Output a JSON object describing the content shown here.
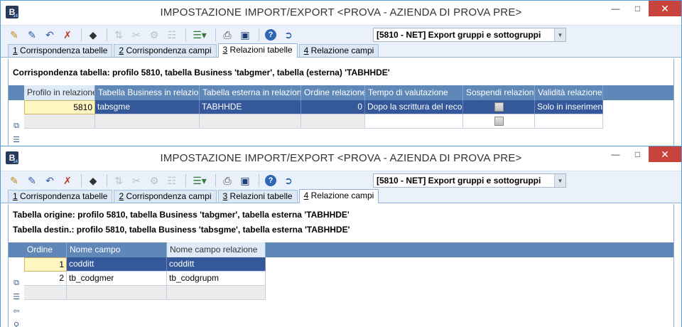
{
  "window_top": {
    "title": "IMPOSTAZIONE IMPORT/EXPORT <PROVA - AZIENDA DI PROVA PRE>",
    "logo_letter": "B",
    "logo_sub": "14",
    "toolbar": {
      "profile_value": "[5810 - NET] Export gruppi e sottogruppi"
    },
    "tabs": [
      {
        "accel": "1",
        "label": " Corrispondenza tabelle"
      },
      {
        "accel": "2",
        "label": " Corrispondenza campi"
      },
      {
        "accel": "3",
        "label": " Relazioni tabelle"
      },
      {
        "accel": "4",
        "label": " Relazione campi"
      }
    ],
    "description": "Corrispondenza tabella: profilo 5810, tabella Business 'tabgmer', tabella (esterna) 'TABHHDE'",
    "grid": {
      "columns": [
        "Profilo in relazione",
        "Tabella Business in relazione",
        "Tabella esterna in relazione",
        "Ordine relazione",
        "Tempo di valutazione",
        "Sospendi relazione",
        "Validità relazione"
      ],
      "rows": [
        [
          "5810",
          "tabsgme",
          "TABHHDE",
          "0",
          "Dopo la scrittura del record",
          "",
          "Solo in inserimento"
        ]
      ]
    }
  },
  "window_bottom": {
    "title": "IMPOSTAZIONE IMPORT/EXPORT <PROVA - AZIENDA DI PROVA PRE>",
    "logo_letter": "B",
    "logo_sub": "14",
    "toolbar": {
      "profile_value": "[5810 - NET] Export gruppi e sottogruppi"
    },
    "tabs": [
      {
        "accel": "1",
        "label": " Corrispondenza tabelle"
      },
      {
        "accel": "2",
        "label": " Corrispondenza campi"
      },
      {
        "accel": "3",
        "label": " Relazioni tabelle"
      },
      {
        "accel": "4",
        "label": " Relazione campi"
      }
    ],
    "description_1": "Tabella origine: profilo 5810, tabella Business 'tabgmer', tabella esterna 'TABHHDE'",
    "description_2": "Tabella destin.: profilo 5810, tabella Business 'tabsgme', tabella esterna 'TABHHDE'",
    "grid": {
      "columns": [
        "Ordine",
        "Nome campo",
        "Nome campo relazione"
      ],
      "rows": [
        [
          "1",
          "codditt",
          "codditt"
        ],
        [
          "2",
          "tb_codgmer",
          "tb_codgrupm"
        ]
      ]
    }
  },
  "colors": {
    "accent": "#5f87b8",
    "selection": "#34589a",
    "focus_cell": "#fff6c2",
    "close": "#c7433b"
  },
  "icons": [
    "edit-icon",
    "edit-save-icon",
    "undo-icon",
    "delete-icon",
    "binoculars-icon",
    "sort-icon",
    "cut-icon",
    "settings-icon",
    "tree-icon",
    "list-icon",
    "print-icon",
    "monitor-icon",
    "help-icon",
    "exit-icon"
  ]
}
